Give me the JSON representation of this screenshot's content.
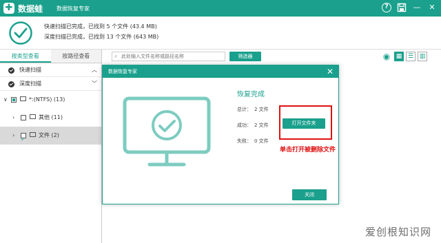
{
  "titlebar": {
    "logo_glyph": "✚",
    "brand": "数据蛙",
    "subtitle": "数据恢复专家",
    "icons": [
      "help-icon",
      "save-icon",
      "minimize-icon",
      "close-icon"
    ]
  },
  "status": {
    "quick": "快速扫描已完成，已找到 5 个文件 (43.4 MB)",
    "deep": "深度扫描已完成，已找到 13 个文件 (643 MB)"
  },
  "sidebar": {
    "tabs": [
      "按类型查看",
      "按路径查看"
    ],
    "scans": [
      "快速扫描",
      "深度扫描"
    ],
    "tree": [
      {
        "label": "*:(NTFS) (13)"
      },
      {
        "label": "其他 (11)"
      },
      {
        "label": "文件 (2)"
      }
    ]
  },
  "toolbar": {
    "search_placeholder": "此处输入文件名称或路径名称",
    "filter_label": "筛选器"
  },
  "dialog": {
    "title": "数据恢复专家",
    "done": "恢复完成",
    "total_label": "总计：",
    "total_value": "2 文件",
    "success_label": "成功：",
    "success_value": "2 文件",
    "fail_label": "失败：",
    "fail_value": "0 文件",
    "open_folder": "打开文件夹",
    "close": "关闭",
    "annotation": "单击打开被删除文件"
  },
  "watermark": "爱创根知识网",
  "colors": {
    "accent": "#1aa08c",
    "annotation": "#e01010"
  }
}
